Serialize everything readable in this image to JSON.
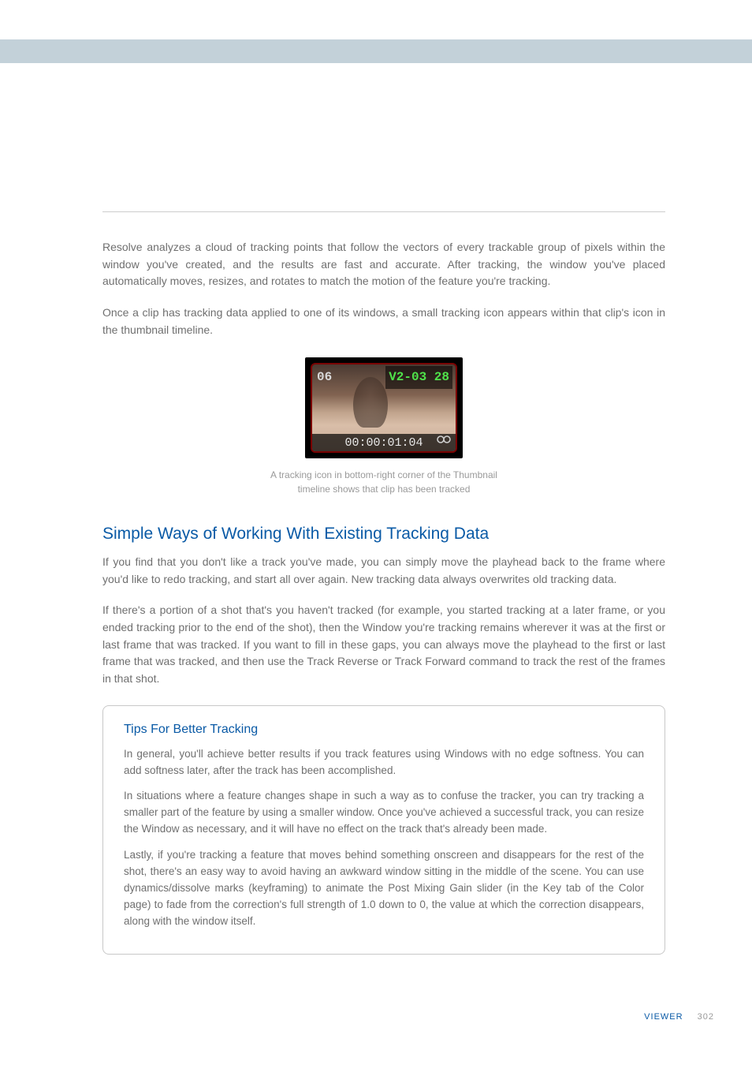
{
  "thumbnail": {
    "index": "06",
    "label": "V2-03 28",
    "timecode": "00:00:01:04",
    "track_icon_name": "tracking-icon"
  },
  "paragraphs": {
    "p1": "Resolve analyzes a cloud of tracking points that follow the vectors of every trackable group of pixels within the window you've created, and the results are fast and accurate. After tracking, the window you've placed automatically moves, resizes, and rotates to match the motion of the feature you're tracking.",
    "p2": "Once a clip has tracking data applied to one of its windows, a small tracking icon appears within that clip's icon in the thumbnail timeline."
  },
  "figcaption": {
    "line1": "A tracking icon in bottom-right corner of the Thumbnail",
    "line2": "timeline shows that clip has been tracked"
  },
  "section": {
    "title": "Simple Ways of Working With Existing Tracking Data",
    "p1": "If you find that you don't like a track you've made, you can simply move the playhead back to the frame where you'd like to redo tracking, and start all over again. New tracking data always overwrites old tracking data.",
    "p2": "If there's a portion of a shot that's you haven't tracked (for example, you started tracking at a later frame, or you ended tracking prior to the end of the shot), then the Window you're tracking remains wherever it was at the first or last frame that was tracked. If you want to fill in these gaps, you can always move the playhead to the first or last frame that was tracked, and then use the Track Reverse or Track Forward command to track the rest of the frames in that shot."
  },
  "tipbox": {
    "title": "Tips For Better Tracking",
    "p1": "In general, you'll achieve better results if you track features using Windows with no edge softness. You can add softness later, after the track has been accomplished.",
    "p2": "In situations where a feature changes shape in such a way as to confuse the tracker, you can try tracking a smaller part of the feature by using a smaller window. Once you've achieved a successful track, you can resize the Window as necessary, and it will have no effect on the track that's already been made.",
    "p3": "Lastly, if you're tracking a feature that moves behind something onscreen and disappears for the rest of the shot, there's an easy way to avoid having an awkward window sitting in the middle of the scene. You can use dynamics/dissolve marks (keyframing) to animate the Post Mixing Gain slider (in the Key tab of the Color page) to fade from the correction's full strength of 1.0 down to 0, the value at which the correction disappears, along with the window itself."
  },
  "footer": {
    "label": "VIEWER",
    "page": "302"
  }
}
